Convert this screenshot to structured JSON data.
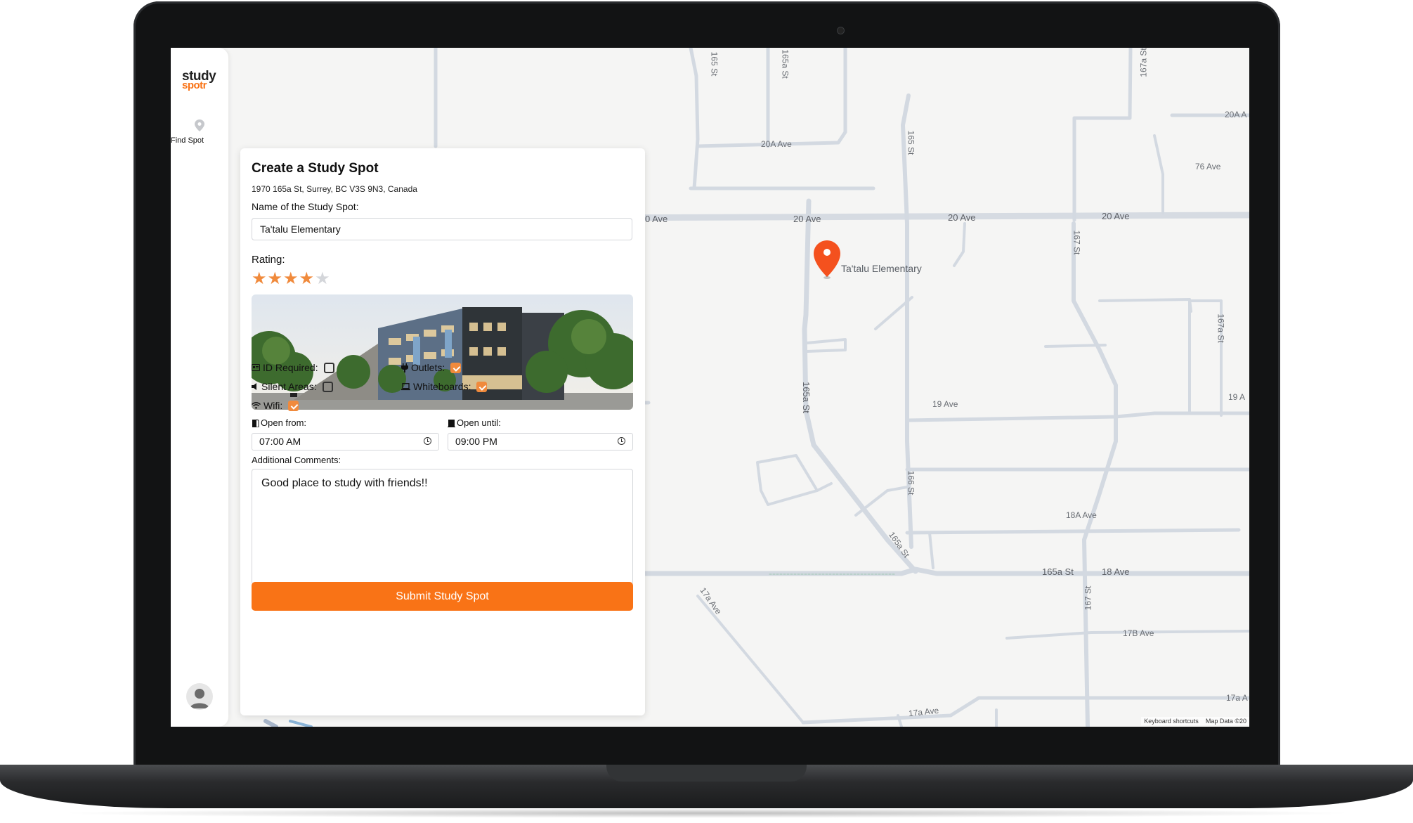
{
  "app": {
    "logo_line1": "study",
    "logo_line2": "spotr",
    "brand_color": "#f97316"
  },
  "sidebar": {
    "nav_find_label": "Find Spot",
    "nav_find_icon": "location-pin-icon",
    "avatar_icon": "user-avatar-icon"
  },
  "form": {
    "title": "Create a Study Spot",
    "address": "1970 165a St, Surrey, BC V3S 9N3, Canada",
    "name_label": "Name of the Study Spot:",
    "name_value": "Ta'talu Elementary",
    "rating_label": "Rating:",
    "rating_value": 4,
    "rating_max": 5,
    "amenities": {
      "id_required": {
        "label": "ID Required:",
        "checked": false,
        "icon": "id-card-icon"
      },
      "outlets": {
        "label": "Outlets:",
        "checked": true,
        "icon": "plug-icon"
      },
      "silent_areas": {
        "label": "Silent Areas:",
        "checked": false,
        "icon": "speaker-icon"
      },
      "whiteboards": {
        "label": "Whiteboards:",
        "checked": true,
        "icon": "laptop-icon"
      },
      "wifi": {
        "label": "Wifi:",
        "checked": true,
        "icon": "wifi-icon"
      }
    },
    "open_from_label": "Open from:",
    "open_from_value": "07:00 AM",
    "open_until_label": "Open until:",
    "open_until_value": "09:00 PM",
    "comments_label": "Additional Comments:",
    "comments_value": "Good place to study with friends!!",
    "submit_label": "Submit Study Spot",
    "checkbox_color": "#f08a3c"
  },
  "map": {
    "marker_label": "Ta'talu Elementary",
    "marker_color": "#f4511e",
    "footer_shortcuts": "Keyboard shortcuts",
    "footer_data": "Map Data ©20",
    "street_labels": {
      "s165": "165 St",
      "s165a_top": "165a St",
      "s167a_top": "167a St",
      "ave20a_left": "20A Ave",
      "ave20a_right": "20A A",
      "ave76": "76 Ave",
      "s165b": "165 St",
      "ave20_cut": "0 Ave",
      "ave20_1": "20 Ave",
      "ave20_2": "20 Ave",
      "ave20_3": "20 Ave",
      "s167_mid": "167 St",
      "s167a_right": "167a St",
      "s165a_mid": "165a St",
      "ave19": "19 Ave",
      "ave19_right": "19 A",
      "s166": "166 St",
      "ave18a": "18A Ave",
      "s165a_diag": "165a St",
      "s165a_bottom": "165a St",
      "ave18": "18 Ave",
      "s17a_ave": "17a Ave",
      "s167_bottom": "167 St",
      "ave17b": "17B Ave",
      "ave17a": "17a Ave",
      "ave17a_right": "17a A"
    }
  }
}
